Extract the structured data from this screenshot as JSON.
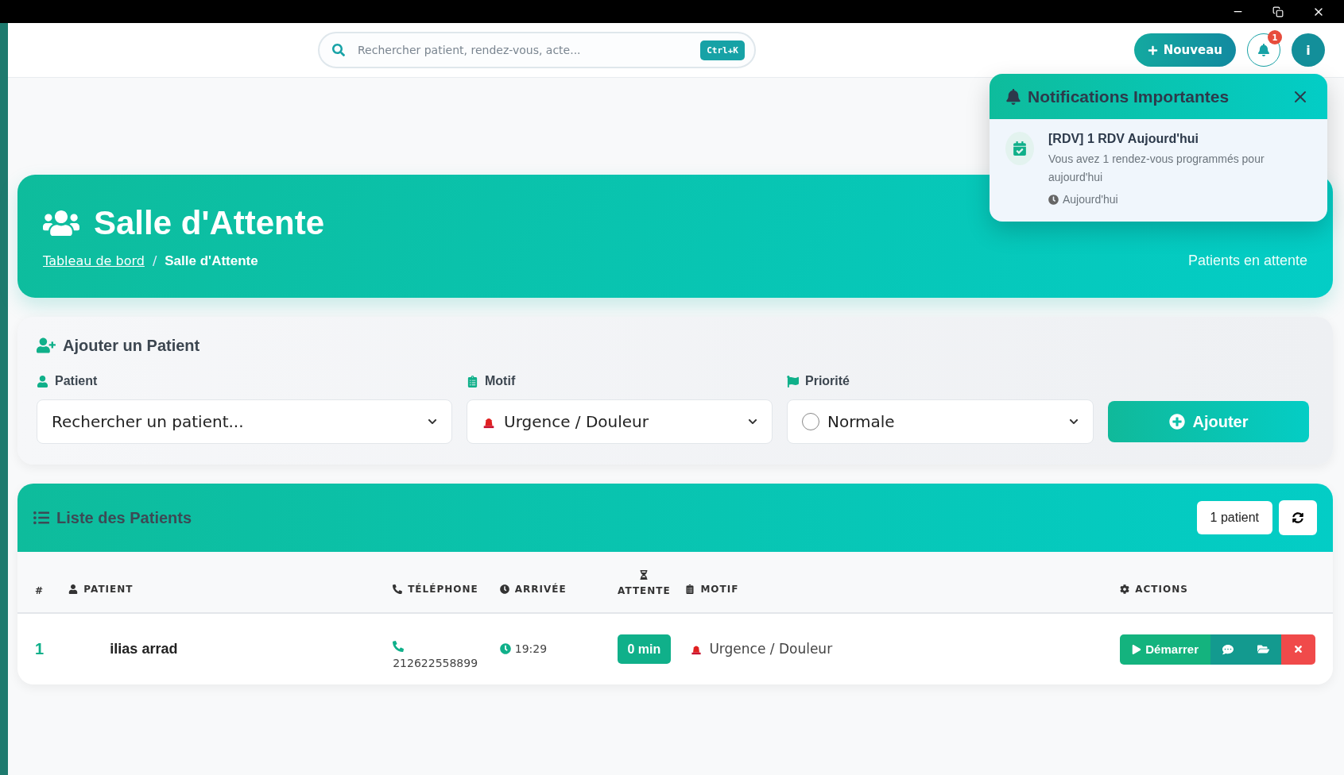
{
  "topbar": {
    "search": {
      "placeholder": "Rechercher patient, rendez-vous, acte...",
      "shortcut": "Ctrl+K"
    },
    "new_button": "Nouveau",
    "notification_count": "1",
    "info_button": "i"
  },
  "notifications": {
    "title": "Notifications Importantes",
    "items": [
      {
        "title": "[RDV] 1 RDV Aujourd'hui",
        "message": "Vous avez 1 rendez-vous programmés pour aujourd'hui",
        "time": "Aujourd'hui"
      }
    ]
  },
  "header": {
    "title": "Salle d'Attente",
    "breadcrumb": [
      {
        "label": "Tableau de bord",
        "link": true
      },
      {
        "label": "Salle d'Attente",
        "link": false
      }
    ],
    "separator": "/",
    "stat_label": "Patients en attente"
  },
  "add_form": {
    "title": "Ajouter un Patient",
    "fields": [
      {
        "kind": "patient",
        "label": "Patient",
        "value": "Rechercher un patient..."
      },
      {
        "kind": "motif",
        "label": "Motif",
        "value": "Urgence / Douleur"
      },
      {
        "kind": "priority",
        "label": "Priorité",
        "value": "Normale"
      }
    ],
    "submit": "Ajouter"
  },
  "list": {
    "title": "Liste des Patients",
    "count": "1 patient",
    "columns": [
      {
        "kind": "num",
        "label": "#"
      },
      {
        "kind": "patient",
        "label": "PATIENT"
      },
      {
        "kind": "phone",
        "label": "TÉLÉPHONE"
      },
      {
        "kind": "arrival",
        "label": "ARRIVÉE"
      },
      {
        "kind": "wait",
        "label": "ATTENTE"
      },
      {
        "kind": "motif",
        "label": "MOTIF"
      },
      {
        "kind": "actions",
        "label": "ACTIONS"
      }
    ],
    "rows": [
      {
        "num": "1",
        "patient": "ilias arrad",
        "phone": "212622558899",
        "arrival": "19:29",
        "wait": "0 min",
        "motif": "Urgence / Douleur",
        "start": "Démarrer"
      }
    ]
  }
}
